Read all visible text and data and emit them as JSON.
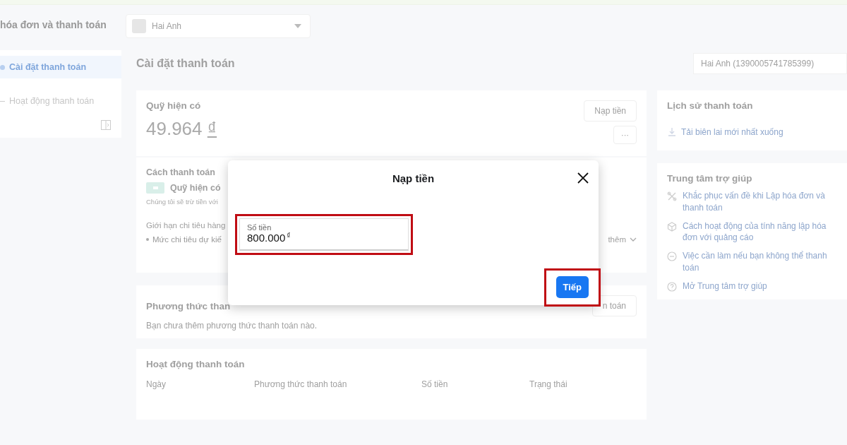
{
  "header": {
    "title": "hóa đơn và thanh toán",
    "account_select": {
      "value": "Hai Anh"
    }
  },
  "sidebar": {
    "items": [
      {
        "label": "Cài đặt thanh toán",
        "selected": true
      },
      {
        "label": "Hoạt động thanh toán",
        "selected": false
      }
    ]
  },
  "page_title": "Cài đặt thanh toán",
  "account_picker": {
    "value": "Hai Anh (1390005741785399)"
  },
  "funds_card": {
    "title": "Quỹ hiện có",
    "amount": "49.964",
    "currency": "₫",
    "add_funds_button": "Nạp tiền",
    "more_button": "···"
  },
  "payment_card": {
    "title": "Cách thanh toán",
    "method": "Quỹ hiện có",
    "note": "Chúng tôi sẽ trừ tiền với",
    "limit_title": "Giới hạn chi tiêu hàng",
    "limit_item": "Mức chi tiêu dự kiế",
    "more_link": "thêm"
  },
  "methods_card": {
    "title": "Phương thức than",
    "button": "n toán",
    "empty_text": "Bạn chưa thêm phương thức thanh toán nào."
  },
  "activity_card": {
    "title": "Hoạt động thanh toán",
    "columns": [
      "Ngày",
      "Phương thức thanh toán",
      "Số tiền",
      "Trạng thái"
    ]
  },
  "history_card": {
    "title": "Lịch sử thanh toán",
    "download_link": "Tải biên lai mới nhất xuống"
  },
  "help_card": {
    "title": "Trung tâm trợ giúp",
    "links": [
      {
        "kind": "tools",
        "label": "Khắc phục vấn đề khi Lập hóa đơn và thanh toán"
      },
      {
        "kind": "cube",
        "label": "Cách hoạt động của tính năng lập hóa đơn với quảng cáo"
      },
      {
        "kind": "minus",
        "label": "Việc cần làm nếu bạn không thể thanh toán"
      },
      {
        "kind": "question",
        "label": "Mở Trung tâm trợ giúp"
      }
    ]
  },
  "dialog": {
    "title": "Nạp tiền",
    "amount_field": {
      "label": "Số tiền",
      "value": "800.000",
      "currency": "₫",
      "highlighted": true
    },
    "next_button": {
      "label": "Tiếp",
      "highlighted": true
    }
  }
}
